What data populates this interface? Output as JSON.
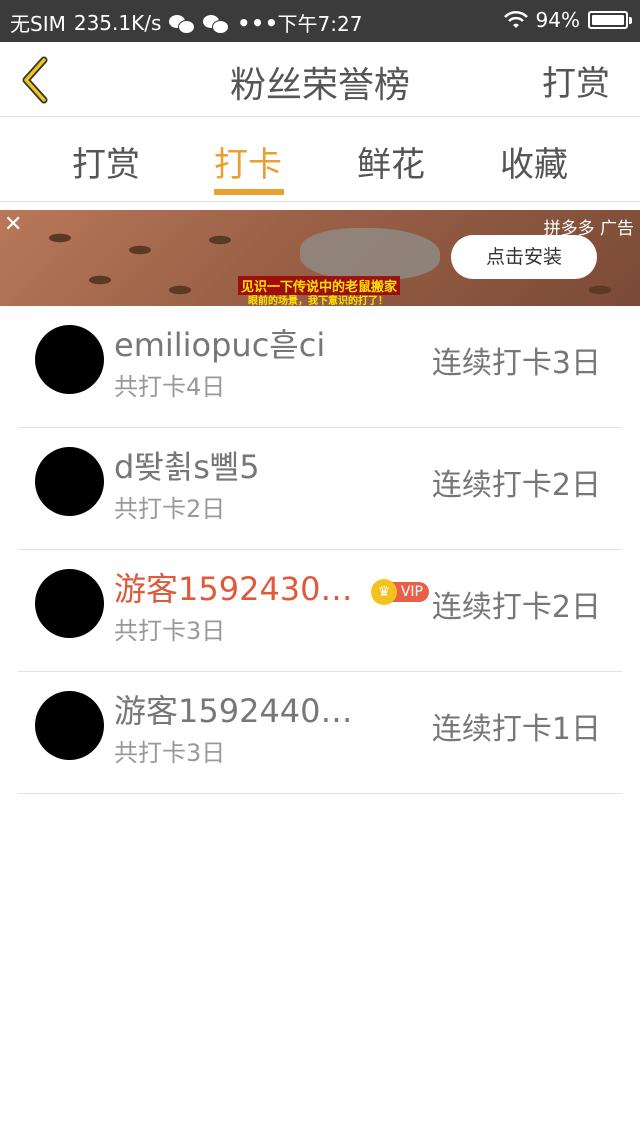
{
  "status_bar": {
    "carrier": "无SIM",
    "speed": "235.1K/s",
    "dots": "•••",
    "time": "下午7:27",
    "battery": "94%",
    "icons": [
      "wechat-icon",
      "wechat-icon",
      "wifi-icon",
      "battery-icon"
    ]
  },
  "nav": {
    "title": "粉丝荣誉榜",
    "action": "打赏",
    "back_icon": "chevron-left-icon"
  },
  "tabs": [
    {
      "label": "打赏"
    },
    {
      "label": "打卡",
      "active": true
    },
    {
      "label": "鲜花"
    },
    {
      "label": "收藏"
    }
  ],
  "ad": {
    "close": "✕",
    "sponsor": "拼多多 广告",
    "install": "点击安装",
    "caption1": "见识一下传说中的老鼠搬家",
    "caption2": "眼前的场景，我下意识的打了！"
  },
  "rows": [
    {
      "name": "emiliopuc흗ci",
      "total": "共打卡4日",
      "streak": "连续打卡3日",
      "vip": false
    },
    {
      "name": "d뙂쵥s뼬5",
      "total": "共打卡2日",
      "streak": "连续打卡2日",
      "vip": false
    },
    {
      "name": "游客1592430…",
      "total": "共打卡3日",
      "streak": "连续打卡2日",
      "vip": true,
      "vip_label": "VIP"
    },
    {
      "name": "游客1592440…",
      "total": "共打卡3日",
      "streak": "连续打卡1日",
      "vip": false
    }
  ],
  "colors": {
    "accent": "#e8a12e",
    "vip_name": "#e0593a",
    "status_bar": "#3b3b3b"
  }
}
